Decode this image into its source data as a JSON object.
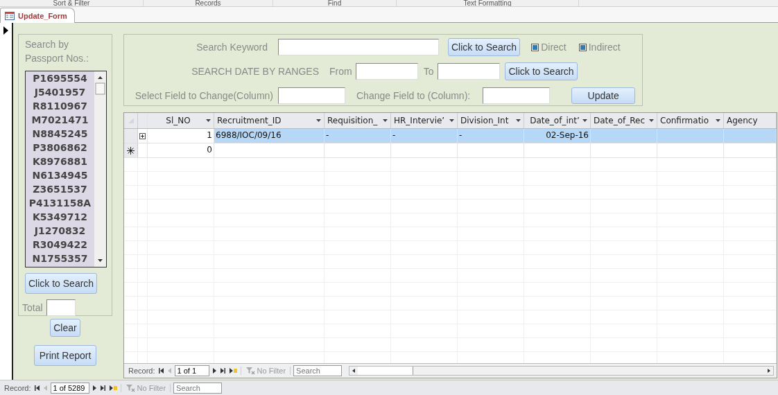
{
  "ribbon": {
    "groups": [
      "Sort & Filter",
      "Records",
      "Find",
      "Text Formatting"
    ]
  },
  "document_tab": {
    "label": "Update_Form",
    "selected": true
  },
  "passport_panel": {
    "title": "Search by Passport Nos.:",
    "items": [
      "P1695554",
      "J5401957",
      "R8110967",
      "M7021471",
      "N8845245",
      "P3806862",
      "K8976881",
      "N6134945",
      "Z3651537",
      "P4131158A",
      "K5349712",
      "J1270832",
      "R3049422",
      "N1755357"
    ],
    "search_button": "Click to Search",
    "total_label": "Total"
  },
  "clear_button": "Clear",
  "print_button": "Print Report",
  "search_panel": {
    "keyword_label": "Search Keyword",
    "keyword_button": "Click to Search",
    "options": [
      {
        "label": "Direct",
        "checked": true
      },
      {
        "label": "Indirect",
        "checked": true
      }
    ],
    "date_label": "SEARCH DATE BY RANGES",
    "from_label": "From",
    "to_label": "To",
    "date_button": "Click to Search",
    "select_field_label": "Select Field to Change(Column)",
    "change_field_label": "Change Field to (Column):",
    "update_button": "Update"
  },
  "table": {
    "columns": [
      {
        "label": "Sl_NO",
        "kind": "number",
        "dropdown": true
      },
      {
        "label": "Recruitment_ID",
        "kind": "text",
        "dropdown": true
      },
      {
        "label": "Requisition_",
        "kind": "text",
        "dropdown": true
      },
      {
        "label": "HR_Intervie’",
        "kind": "text",
        "dropdown": true
      },
      {
        "label": "Division_Int",
        "kind": "text",
        "dropdown": true
      },
      {
        "label": "Date_of_int’",
        "kind": "number",
        "dropdown": true
      },
      {
        "label": "Date_of_Rec",
        "kind": "text",
        "dropdown": true
      },
      {
        "label": "Confirmatio",
        "kind": "text",
        "dropdown": true
      },
      {
        "label": "Agency",
        "kind": "text",
        "dropdown": false
      }
    ],
    "rows": [
      {
        "kind": "record",
        "selected": true,
        "cells": [
          "1",
          "6988/IOC/09/16",
          "-",
          "-",
          "-",
          "02-Sep-16"
        ]
      },
      {
        "kind": "new",
        "selected": false,
        "cells": [
          "0"
        ]
      }
    ],
    "navigation": {
      "label": "Record:",
      "position": "1 of 1",
      "filter": "No Filter",
      "search_placeholder": "Search"
    }
  },
  "status_bar": {
    "label": "Record:",
    "position": "1 of 5289",
    "filter": "No Filter",
    "search_placeholder": "Search"
  }
}
